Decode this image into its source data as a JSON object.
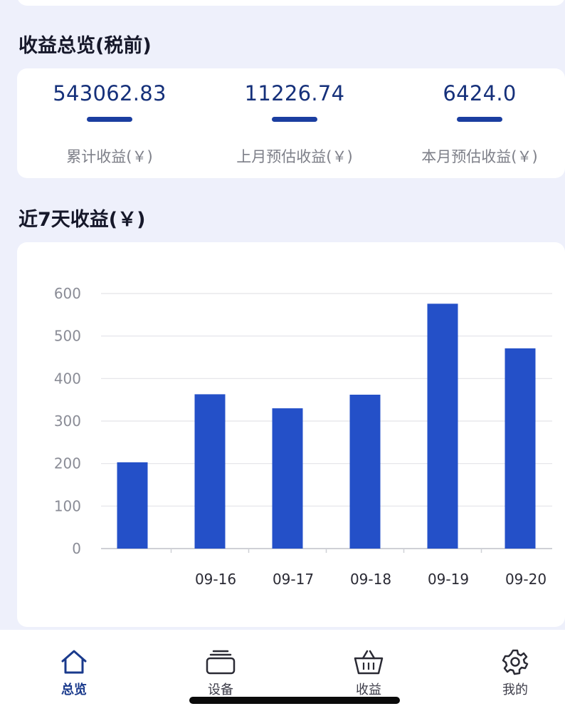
{
  "overview": {
    "title": "收益总览(税前)",
    "stats": [
      {
        "value": "543062.83",
        "label": "累计收益(￥)"
      },
      {
        "value": "11226.74",
        "label": "上月预估收益(￥)"
      },
      {
        "value": "6424.0",
        "label": "本月预估收益(￥)"
      }
    ]
  },
  "chart_section": {
    "title": "近7天收益(￥)"
  },
  "chart_data": {
    "type": "bar",
    "categories": [
      "",
      "09-16",
      "09-17",
      "09-18",
      "09-19",
      "09-20"
    ],
    "values": [
      203,
      363,
      330,
      362,
      576,
      471
    ],
    "yticks": [
      "0",
      "100",
      "200",
      "300",
      "400",
      "500",
      "600"
    ],
    "ylim": [
      0,
      600
    ],
    "grid": true,
    "bar_color": "#2450c8"
  },
  "tabbar": {
    "items": [
      {
        "label": "总览",
        "icon": "home-icon",
        "active": true
      },
      {
        "label": "设备",
        "icon": "device-stack-icon",
        "active": false
      },
      {
        "label": "收益",
        "icon": "basket-icon",
        "active": false
      },
      {
        "label": "我的",
        "icon": "gear-icon",
        "active": false
      }
    ]
  },
  "colors": {
    "accent": "#1b3ea0",
    "value_text": "#15307a",
    "page_bg": "#eef0fb"
  }
}
